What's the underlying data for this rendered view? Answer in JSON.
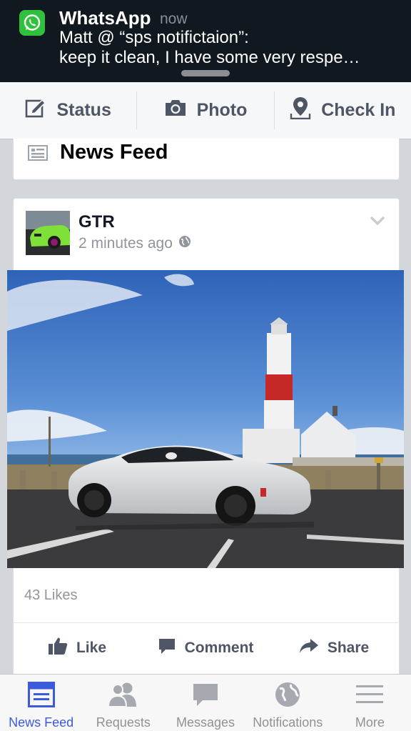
{
  "notification": {
    "app": "WhatsApp",
    "time": "now",
    "line1": "Matt @ “sps notifictaion”:",
    "line2": "keep it clean,  I have some very respe…"
  },
  "composer": {
    "status": "Status",
    "photo": "Photo",
    "checkin": "Check In"
  },
  "feed_header": {
    "title": "News Feed"
  },
  "post": {
    "author": "GTR",
    "timestamp": "2 minutes ago",
    "likes": "43 Likes",
    "actions": {
      "like": "Like",
      "comment": "Comment",
      "share": "Share"
    }
  },
  "tabbar": {
    "items": [
      {
        "label": "News Feed",
        "icon": "news-feed-icon",
        "active": true
      },
      {
        "label": "Requests",
        "icon": "requests-icon",
        "active": false
      },
      {
        "label": "Messages",
        "icon": "messages-icon",
        "active": false
      },
      {
        "label": "Notifications",
        "icon": "notifications-icon",
        "active": false
      },
      {
        "label": "More",
        "icon": "more-icon",
        "active": false
      }
    ]
  },
  "colors": {
    "accent": "#3b5bdb",
    "whatsapp_green": "#2fc13d",
    "banner_bg": "#111820",
    "inactive_icon": "#8e9196"
  }
}
